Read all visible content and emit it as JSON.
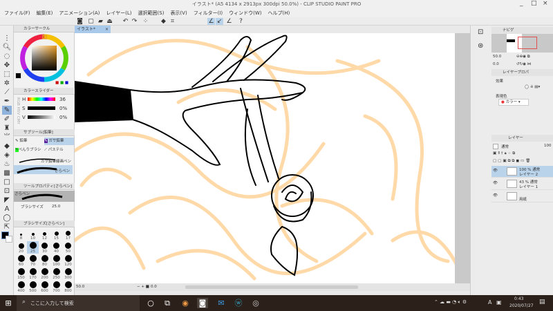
{
  "window": {
    "title": "イラスト* (A5 4134 x 2913px 300dpi 50.0%) - CLIP STUDIO PAINT PRO",
    "minimize": "_",
    "maximize": "□",
    "close": "×"
  },
  "menu": [
    "ファイル(F)",
    "編集(E)",
    "アニメーション(A)",
    "レイヤー(L)",
    "選択範囲(S)",
    "表示(V)",
    "フィルター(I)",
    "ウィンドウ(W)",
    "ヘルプ(H)"
  ],
  "canvas_tab": {
    "label": "イラスト*",
    "close": "×"
  },
  "color_circle": {
    "title": "カラーサークル",
    "main_color": "#000000",
    "sub_color": "#ffffff",
    "hue_marker_color": "#e8a020"
  },
  "color_slider": {
    "title": "カラースライダー",
    "modes": [
      "RGB",
      "HSV",
      "CMY"
    ],
    "rows": [
      {
        "label": "H",
        "value": "36"
      },
      {
        "label": "S",
        "value": "0%"
      },
      {
        "label": "V",
        "value": "0%"
      }
    ]
  },
  "sub_tool": {
    "title": "サブツール[鉛筆]",
    "tools": [
      "鉛筆",
      "ガサ鉛筆",
      "べんりブラシ",
      "パステル"
    ],
    "brushes": [
      "ガサ鉛筆線画ペン",
      "さらペン"
    ],
    "selected_brush": "さらペン"
  },
  "tool_property": {
    "title": "ツールプロパティ[さらペン]",
    "brush_name": "さらペン",
    "brush_size_label": "ブラシサイズ",
    "brush_size_value": "25.0"
  },
  "brush_size": {
    "title": "ブラシサイズ[さらペン]",
    "sizes": [
      "8",
      "10",
      "12",
      "15",
      "17",
      "20",
      "25",
      "30",
      "40",
      "50",
      "60",
      "70",
      "80",
      "100",
      "120",
      "150",
      "170",
      "200",
      "250",
      "300",
      "400",
      "500",
      "600",
      "700",
      "800"
    ],
    "selected": "25"
  },
  "status": {
    "zoom": "50.0",
    "rotation": "0.0"
  },
  "navigator": {
    "title": "ナビゲ",
    "zoom": "50.0",
    "angle": "0.0"
  },
  "layer_property": {
    "title": "レイヤープロパ",
    "effect_label": "効果",
    "expression_label": "表現色",
    "expression_value": "カラー"
  },
  "layers": {
    "title": "レイヤー",
    "blend_mode": "通常",
    "opacity": "100",
    "items": [
      {
        "meta": "100 % 通常",
        "name": "レイヤー 2",
        "selected": true
      },
      {
        "meta": "43 % 通常",
        "name": "レイヤー 1",
        "selected": false
      },
      {
        "meta": "",
        "name": "用紙",
        "selected": false
      }
    ]
  },
  "taskbar": {
    "search_placeholder": "ここに入力して検索",
    "time": "0:43",
    "date": "2020/07/27",
    "ime": "A"
  },
  "colors": {
    "sketch": "#ffd9a8",
    "selection": "#b9d3ea",
    "taskbar": "#2c211a"
  }
}
